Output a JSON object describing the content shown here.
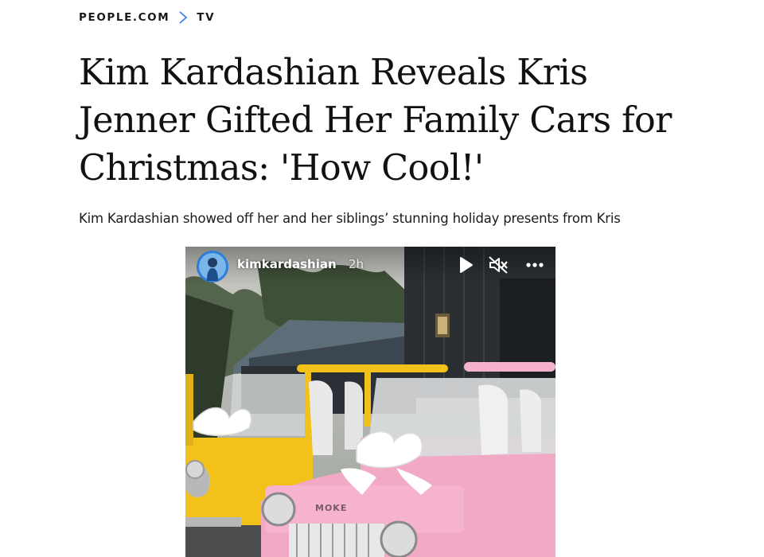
{
  "breadcrumb": {
    "site": "PEOPLE.COM",
    "section": "TV"
  },
  "article": {
    "headline_lines": [
      "Kim Kardashian Reveals Kris",
      "Jenner Gifted Her Family Cars for",
      "Christmas: 'How Cool!'"
    ],
    "dek": "Kim Kardashian showed off her and her siblings’ stunning holiday presents from Kris"
  },
  "story": {
    "username": "kimkardashian",
    "time": "2h",
    "car_badge": "MOKE",
    "icons": [
      "play-icon",
      "muted-speaker-icon",
      "more-options-icon"
    ]
  },
  "colors": {
    "breadcrumb_separator": "#3b7ff0",
    "car_yellow": "#f2c21b",
    "car_pink": "#f2a9c6",
    "avatar_ring": "#2f7fd6"
  }
}
